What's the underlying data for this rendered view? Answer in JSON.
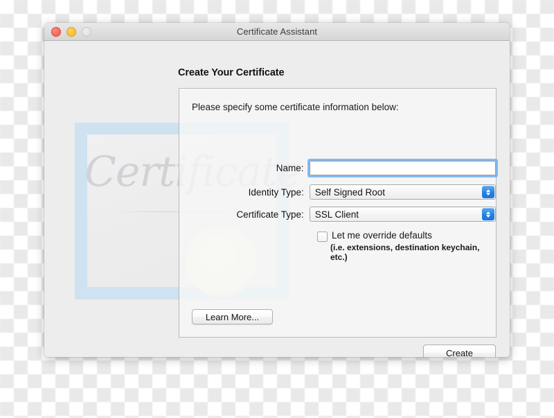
{
  "window": {
    "title": "Certificate Assistant",
    "traffic_lights": [
      {
        "name": "close",
        "color": "#f9534a"
      },
      {
        "name": "minimize",
        "color": "#f7b820"
      },
      {
        "name": "zoom",
        "color": "#dcdcdc"
      }
    ]
  },
  "page": {
    "heading": "Create Your Certificate",
    "instruction": "Please specify some certificate information below:"
  },
  "decoration": {
    "script_text": "Certificate",
    "frame_color": "#c8dff0",
    "seal_color": "#f6f5e6"
  },
  "form": {
    "name": {
      "label": "Name:",
      "value": "",
      "placeholder": "",
      "focused": true
    },
    "identity_type": {
      "label": "Identity Type:",
      "value": "Self Signed Root"
    },
    "certificate_type": {
      "label": "Certificate Type:",
      "value": "SSL Client"
    },
    "override": {
      "checked": false,
      "label": "Let me override defaults",
      "hint": "(i.e. extensions, destination keychain, etc.)"
    }
  },
  "buttons": {
    "learn_more": "Learn More...",
    "create": "Create"
  },
  "accent_color": "#2380e0"
}
